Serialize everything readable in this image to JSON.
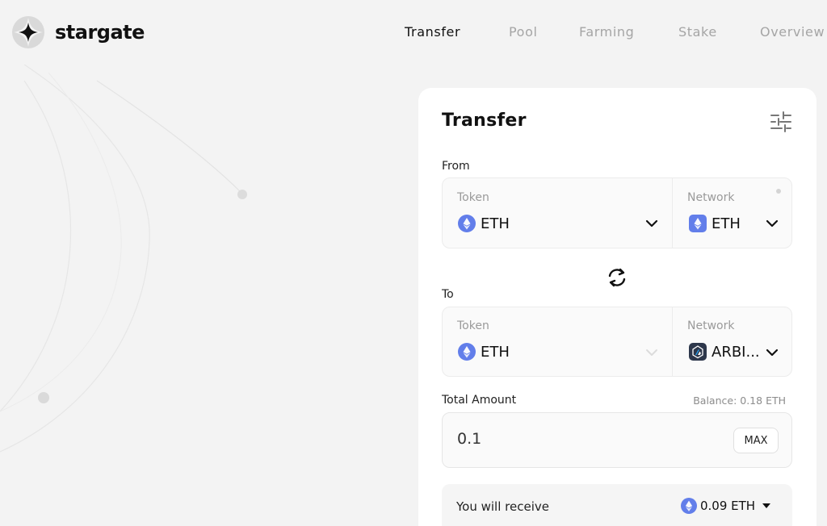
{
  "brand": {
    "name": "stargate"
  },
  "nav": {
    "items": [
      {
        "label": "Transfer",
        "active": true
      },
      {
        "label": "Pool",
        "active": false
      },
      {
        "label": "Farming",
        "active": false
      },
      {
        "label": "Stake",
        "active": false
      },
      {
        "label": "Overview",
        "active": false
      }
    ]
  },
  "transfer": {
    "title": "Transfer",
    "settings_icon": "sliders-icon",
    "from": {
      "label": "From",
      "token_label": "Token",
      "token_value": "ETH",
      "network_label": "Network",
      "network_value": "ETH"
    },
    "swap_icon": "swap-arrows-icon",
    "to": {
      "label": "To",
      "token_label": "Token",
      "token_value": "ETH",
      "network_label": "Network",
      "network_value": "ARBI..."
    },
    "total_amount_label": "Total Amount",
    "balance": "Balance: 0.18 ETH",
    "amount_value": "0.1",
    "max_label": "MAX",
    "receive_label": "You will receive",
    "receive_value": "0.09 ETH"
  },
  "colors": {
    "eth": "#627eea",
    "arbitrum_bg": "#2d374b",
    "text_muted": "#a5a5a5"
  }
}
